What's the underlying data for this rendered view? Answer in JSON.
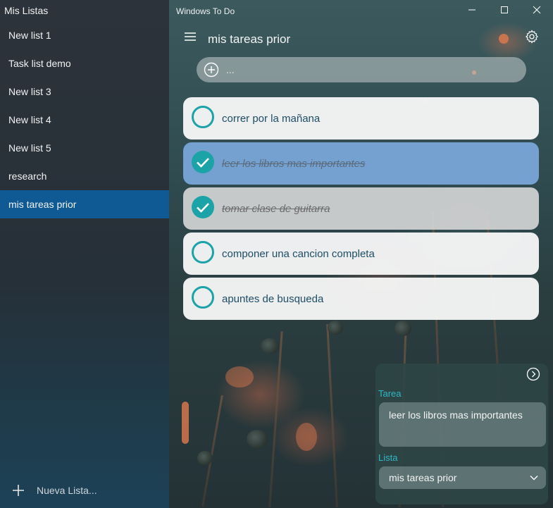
{
  "sidebar": {
    "title": "Mis Listas",
    "items": [
      {
        "label": "New list 1"
      },
      {
        "label": "Task list demo"
      },
      {
        "label": "New list 3"
      },
      {
        "label": "New list 4"
      },
      {
        "label": "New list 5"
      },
      {
        "label": "research"
      },
      {
        "label": "mis tareas prior",
        "selected": true
      }
    ],
    "new_list_label": "Nueva Lista...",
    "new_list_icon": "plus-icon",
    "selected_color": "#0f5a94"
  },
  "window": {
    "title": "Windows To Do",
    "controls": [
      "minimize-icon",
      "maximize-icon",
      "close-icon"
    ]
  },
  "header": {
    "menu_icon": "hamburger-icon",
    "list_title": "mis tareas prior",
    "settings_icon": "gear-icon"
  },
  "add_task": {
    "placeholder": "...",
    "icon": "add-circle-icon"
  },
  "tasks": [
    {
      "text": "correr por la mañana",
      "completed": false,
      "selected": false
    },
    {
      "text": "leer los libros mas importantes",
      "completed": true,
      "selected": true
    },
    {
      "text": "tomar clase de guitarra",
      "completed": true,
      "selected": false
    },
    {
      "text": "componer una cancion completa",
      "completed": false,
      "selected": false
    },
    {
      "text": "apuntes de busqueda",
      "completed": false,
      "selected": false
    }
  ],
  "detail_panel": {
    "close_icon": "chevron-right-circle-icon",
    "task_label": "Tarea",
    "task_value": "leer los libros mas importantes",
    "list_label": "Lista",
    "list_value": "mis tareas prior",
    "accent_color": "#2fb9c7"
  },
  "colors": {
    "check_teal": "#1ba3a8",
    "selected_task": "#78a4d6"
  }
}
